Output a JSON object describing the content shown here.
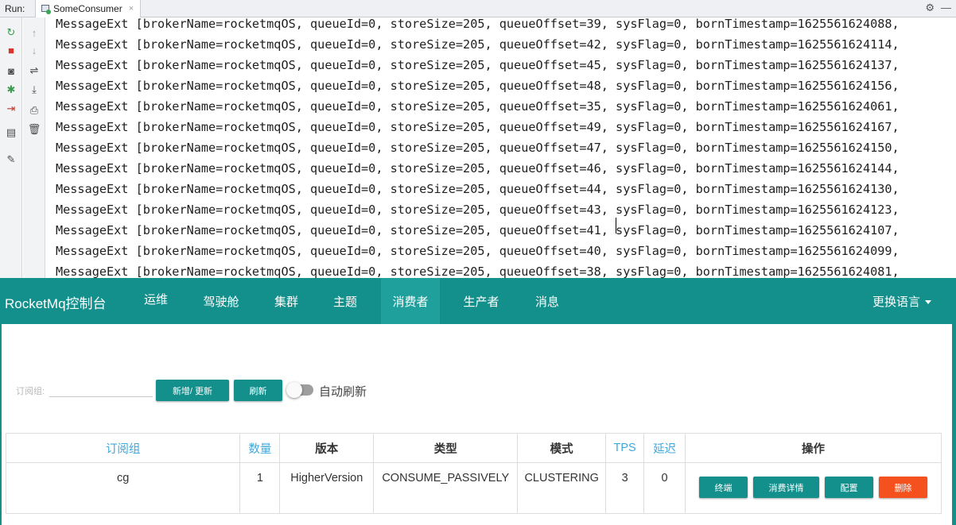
{
  "ide": {
    "run_label": "Run:",
    "tab_title": "SomeConsumer",
    "tab_close": "×",
    "settings_glyph": "⚙",
    "minimize_glyph": "—",
    "console_lines": [
      "MessageExt [brokerName=rocketmqOS, queueId=0, storeSize=205, queueOffset=39, sysFlag=0, bornTimestamp=1625561624088,",
      "MessageExt [brokerName=rocketmqOS, queueId=0, storeSize=205, queueOffset=42, sysFlag=0, bornTimestamp=1625561624114,",
      "MessageExt [brokerName=rocketmqOS, queueId=0, storeSize=205, queueOffset=45, sysFlag=0, bornTimestamp=1625561624137,",
      "MessageExt [brokerName=rocketmqOS, queueId=0, storeSize=205, queueOffset=48, sysFlag=0, bornTimestamp=1625561624156,",
      "MessageExt [brokerName=rocketmqOS, queueId=0, storeSize=205, queueOffset=35, sysFlag=0, bornTimestamp=1625561624061,",
      "MessageExt [brokerName=rocketmqOS, queueId=0, storeSize=205, queueOffset=49, sysFlag=0, bornTimestamp=1625561624167,",
      "MessageExt [brokerName=rocketmqOS, queueId=0, storeSize=205, queueOffset=47, sysFlag=0, bornTimestamp=1625561624150,",
      "MessageExt [brokerName=rocketmqOS, queueId=0, storeSize=205, queueOffset=46, sysFlag=0, bornTimestamp=1625561624144,",
      "MessageExt [brokerName=rocketmqOS, queueId=0, storeSize=205, queueOffset=44, sysFlag=0, bornTimestamp=1625561624130,",
      "MessageExt [brokerName=rocketmqOS, queueId=0, storeSize=205, queueOffset=43, sysFlag=0, bornTimestamp=1625561624123,",
      "MessageExt [brokerName=rocketmqOS, queueId=0, storeSize=205, queueOffset=41, sysFlag=0, bornTimestamp=1625561624107,",
      "MessageExt [brokerName=rocketmqOS, queueId=0, storeSize=205, queueOffset=40, sysFlag=0, bornTimestamp=1625561624099,",
      "MessageExt [brokerName=rocketmqOS, queueId=0, storeSize=205, queueOffset=38, sysFlag=0, bornTimestamp=1625561624081,"
    ],
    "toolbar_left": [
      {
        "icon": "rerun-icon",
        "glyph": "↻",
        "color": "#3a9b4f"
      },
      {
        "icon": "stop-icon",
        "glyph": "■",
        "color": "#d9342b"
      },
      {
        "icon": "camera-icon",
        "glyph": "◙",
        "color": "#4a4a4a"
      },
      {
        "icon": "debug-icon",
        "glyph": "✱",
        "color": "#3a9b4f"
      },
      {
        "icon": "exit-icon",
        "glyph": "⇥",
        "color": "#c0392b"
      },
      {
        "icon": "layout-icon",
        "glyph": "▤",
        "color": "#4a4a4a"
      },
      {
        "icon": "pin-icon",
        "glyph": "✎",
        "color": "#4a4a4a"
      }
    ],
    "toolbar_right": [
      {
        "icon": "up-arrow-icon",
        "glyph": "↑",
        "color": "#a6a6a6"
      },
      {
        "icon": "down-arrow-icon",
        "glyph": "↓",
        "color": "#a6a6a6"
      },
      {
        "icon": "soft-wrap-icon",
        "glyph": "⇌",
        "color": "#4a4a4a"
      },
      {
        "icon": "scroll-to-end-icon",
        "glyph": "⤓",
        "color": "#4a4a4a"
      },
      {
        "icon": "print-icon",
        "glyph": "⎙",
        "color": "#4a4a4a"
      },
      {
        "icon": "trash-icon",
        "glyph": "🗑",
        "color": "#4a4a4a"
      }
    ]
  },
  "app": {
    "brand": "RocketMq控制台",
    "nav": [
      {
        "label": "运维",
        "active": false
      },
      {
        "label": "驾驶舱",
        "active": false
      },
      {
        "label": "集群",
        "active": false
      },
      {
        "label": "主题",
        "active": false
      },
      {
        "label": "消费者",
        "active": true
      },
      {
        "label": "生产者",
        "active": false
      },
      {
        "label": "消息",
        "active": false
      }
    ],
    "language": "更换语言",
    "colors": {
      "primary": "#138f8c",
      "active_nav": "#1fa09c",
      "danger": "#f4511e",
      "link": "#3fa7dc"
    }
  },
  "toolbar": {
    "subscription_label": "订阅组:",
    "subscription_value": "",
    "add_update_button": "新增/ 更新",
    "refresh_button": "刷新",
    "auto_refresh_label": "自动刷新",
    "auto_refresh_on": false
  },
  "table": {
    "headers": [
      {
        "label": "订阅组",
        "link": true
      },
      {
        "label": "数量",
        "link": true
      },
      {
        "label": "版本",
        "link": false
      },
      {
        "label": "类型",
        "link": false
      },
      {
        "label": "模式",
        "link": false
      },
      {
        "label": "TPS",
        "link": true
      },
      {
        "label": "延迟",
        "link": true
      },
      {
        "label": "操作",
        "link": false
      }
    ],
    "rows": [
      {
        "cells": [
          "cg",
          "1",
          "HigherVersion",
          "CONSUME_PASSIVELY",
          "CLUSTERING",
          "3",
          "0"
        ],
        "actions": [
          {
            "label": "终端",
            "danger": false
          },
          {
            "label": "消费详情",
            "danger": false
          },
          {
            "label": "配置",
            "danger": false
          },
          {
            "label": "删除",
            "danger": true
          }
        ]
      }
    ]
  }
}
